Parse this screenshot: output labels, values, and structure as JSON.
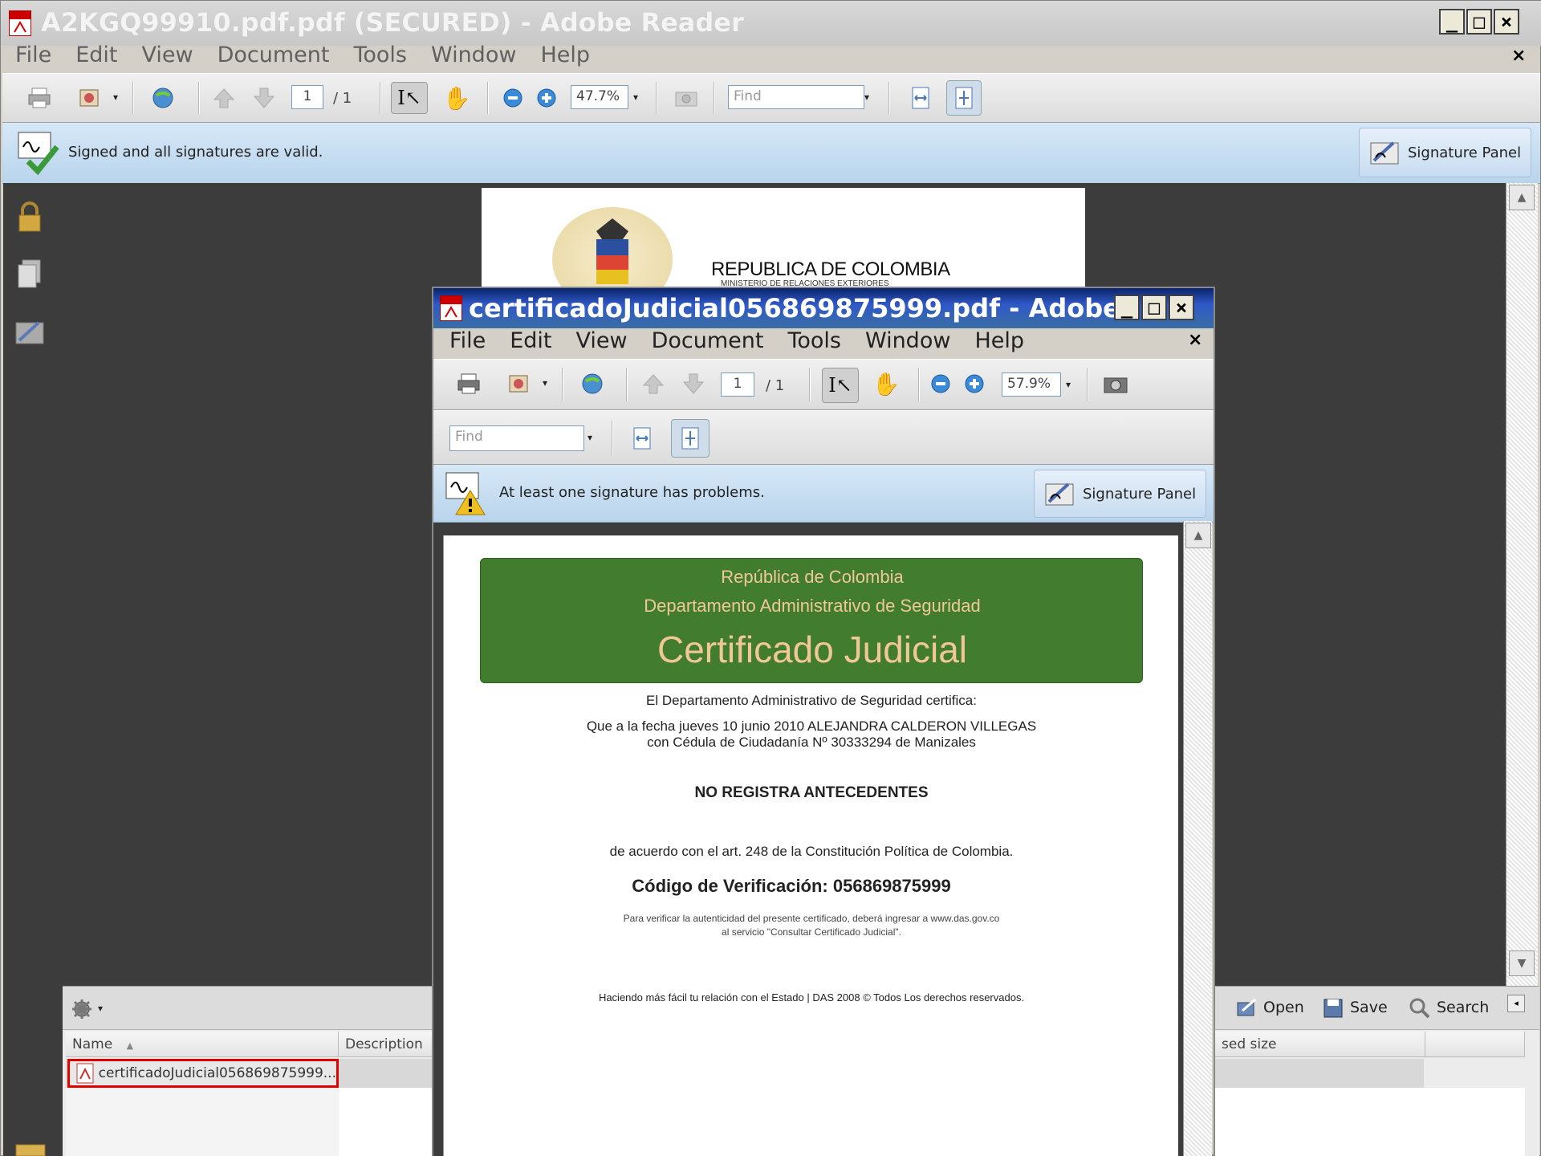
{
  "main_window": {
    "title": "A2KGQ99910.pdf.pdf (SECURED) - Adobe Reader",
    "menu": [
      "File",
      "Edit",
      "View",
      "Document",
      "Tools",
      "Window",
      "Help"
    ],
    "toolbar": {
      "page_current": "1",
      "page_total": "/ 1",
      "zoom": "47.7%",
      "find_placeholder": "Find"
    },
    "signature_message": "Signed and all signatures are valid.",
    "signature_panel_label": "Signature Panel",
    "background_document_heading": "REPUBLICA DE COLOMBIA",
    "background_document_subheading": "MINISTERIO DE RELACIONES EXTERIORES"
  },
  "portfolio": {
    "actions": {
      "open": "Open",
      "save": "Save",
      "search": "Search"
    },
    "columns": {
      "name": "Name",
      "description": "Description",
      "compressed_size": "sed size"
    },
    "files": [
      {
        "name": "certificadoJudicial056869875999...",
        "selected": true
      }
    ]
  },
  "child_window": {
    "title": "certificadoJudicial056869875999.pdf - Adobe ...",
    "menu": [
      "File",
      "Edit",
      "View",
      "Document",
      "Tools",
      "Window",
      "Help"
    ],
    "toolbar": {
      "page_current": "1",
      "page_total": "/ 1",
      "zoom": "57.9%",
      "find_placeholder": "Find"
    },
    "signature_message": "At least one signature has problems.",
    "signature_panel_label": "Signature Panel",
    "document": {
      "header_line1": "República de Colombia",
      "header_line2": "Departamento Administrativo de Seguridad",
      "header_title": "Certificado Judicial",
      "intro": "El Departamento Administrativo de Seguridad certifica:",
      "line1": "Que a la fecha jueves 10 junio 2010 ALEJANDRA CALDERON VILLEGAS",
      "line2": "con Cédula de Ciudadanía Nº 30333294 de Manizales",
      "status": "NO REGISTRA ANTECEDENTES",
      "legal": "de acuerdo con el art. 248 de la Constitución Política de Colombia.",
      "code": "Código de Verificación: 056869875999",
      "verify1": "Para verificar la autenticidad del presente certificado, deberá ingresar a www.das.gov.co",
      "verify2": "al servicio \"Consultar Certificado Judicial\".",
      "footer": "Haciendo más fácil tu relación con el Estado | DAS 2008 © Todos Los derechos reservados."
    }
  },
  "colors": {
    "green_header": "#427c2e",
    "header_text": "#f0c896",
    "signature_bar": "#c6dcf0",
    "selection_outline": "#e00000"
  }
}
